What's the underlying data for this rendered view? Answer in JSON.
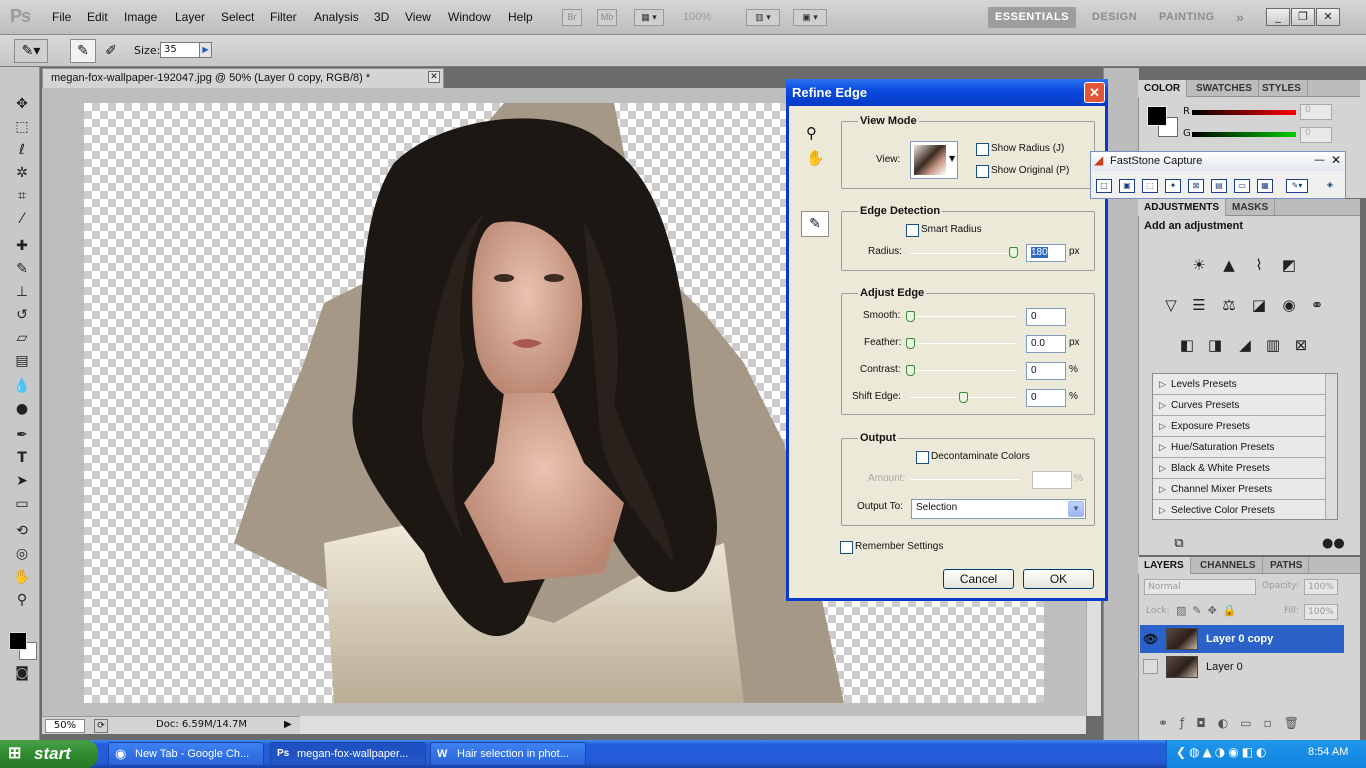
{
  "app": {
    "logo": "Ps"
  },
  "menu": [
    "File",
    "Edit",
    "Image",
    "Layer",
    "Select",
    "Filter",
    "Analysis",
    "3D",
    "View",
    "Window",
    "Help"
  ],
  "appbar": {
    "br_label": "Br",
    "mb_label": "Mb",
    "zoom": "100%"
  },
  "workspaces": {
    "essentials": "ESSENTIALS",
    "design": "DESIGN",
    "painting": "PAINTING",
    "more": "»"
  },
  "options": {
    "size_label": "Size:",
    "size_value": "35"
  },
  "document": {
    "tab_title": "megan-fox-wallpaper-192047.jpg @ 50% (Layer 0 copy, RGB/8) *",
    "zoom": "50%",
    "doc_info": "Doc: 6.59M/14.7M"
  },
  "panels": {
    "color_tabs": [
      "COLOR",
      "SWATCHES",
      "STYLES"
    ],
    "color_channels": [
      {
        "label": "R",
        "value": "0"
      },
      {
        "label": "G",
        "value": "0"
      }
    ],
    "adjust_tabs": [
      "ADJUSTMENTS",
      "MASKS"
    ],
    "adjust_heading": "Add an adjustment",
    "presets": [
      "Levels Presets",
      "Curves Presets",
      "Exposure Presets",
      "Hue/Saturation Presets",
      "Black & White Presets",
      "Channel Mixer Presets",
      "Selective Color Presets"
    ],
    "layer_tabs": [
      "LAYERS",
      "CHANNELS",
      "PATHS"
    ],
    "blend_mode": "Normal",
    "opacity_label": "Opacity:",
    "opacity_value": "100%",
    "lock_label": "Lock:",
    "fill_label": "Fill:",
    "fill_value": "100%",
    "layers": [
      {
        "name": "Layer 0 copy",
        "selected": true,
        "visible": true
      },
      {
        "name": "Layer 0",
        "selected": false,
        "visible": false
      }
    ]
  },
  "dialog": {
    "title": "Refine Edge",
    "view_mode": {
      "heading": "View Mode",
      "view_label": "View:",
      "show_radius": "Show Radius (J)",
      "show_original": "Show Original (P)"
    },
    "edge_detection": {
      "heading": "Edge Detection",
      "smart_radius": "Smart Radius",
      "radius_label": "Radius:",
      "radius_value": "180",
      "radius_unit": "px"
    },
    "adjust_edge": {
      "heading": "Adjust Edge",
      "rows": [
        {
          "label": "Smooth:",
          "value": "0",
          "unit": ""
        },
        {
          "label": "Feather:",
          "value": "0.0",
          "unit": "px"
        },
        {
          "label": "Contrast:",
          "value": "0",
          "unit": "%"
        },
        {
          "label": "Shift Edge:",
          "value": "0",
          "unit": "%"
        }
      ]
    },
    "output": {
      "heading": "Output",
      "decontaminate": "Decontaminate Colors",
      "amount_label": "Amount:",
      "amount_unit": "%",
      "output_to_label": "Output To:",
      "output_to_value": "Selection"
    },
    "remember": "Remember Settings",
    "cancel": "Cancel",
    "ok": "OK"
  },
  "faststone": {
    "title": "FastStone Capture"
  },
  "taskbar": {
    "start": "start",
    "tasks": [
      "New Tab - Google Ch...",
      "megan-fox-wallpaper...",
      "Hair selection in phot..."
    ],
    "clock": "8:54 AM"
  }
}
